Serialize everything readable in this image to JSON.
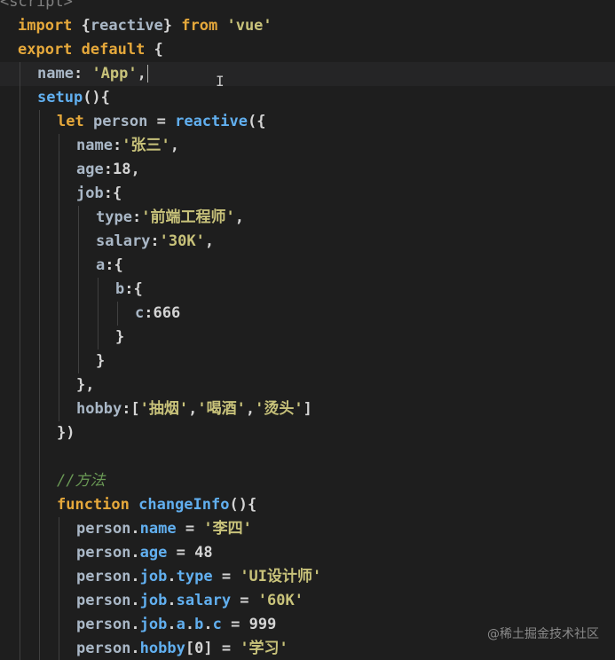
{
  "editor": {
    "lines": [
      {
        "indent": 0,
        "tokens": [
          {
            "t": "<script>",
            "c": "tag"
          }
        ]
      },
      {
        "indent": 0,
        "tokens": [
          {
            "t": "import ",
            "c": "kwo"
          },
          {
            "t": "{",
            "c": "pun"
          },
          {
            "t": "reactive",
            "c": "key"
          },
          {
            "t": "} ",
            "c": "pun"
          },
          {
            "t": "from ",
            "c": "kwo"
          },
          {
            "t": "'vue'",
            "c": "strc"
          }
        ]
      },
      {
        "indent": 0,
        "tokens": [
          {
            "t": "export ",
            "c": "kwo"
          },
          {
            "t": "default ",
            "c": "kwo"
          },
          {
            "t": "{",
            "c": "pun"
          }
        ]
      },
      {
        "indent": 1,
        "cursor": true,
        "tokens": [
          {
            "t": "name",
            "c": "key"
          },
          {
            "t": ": ",
            "c": "pun"
          },
          {
            "t": "'App'",
            "c": "strc"
          },
          {
            "t": ",",
            "c": "pun"
          }
        ]
      },
      {
        "indent": 1,
        "tokens": [
          {
            "t": "setup",
            "c": "fnc"
          },
          {
            "t": "(){",
            "c": "pun"
          }
        ]
      },
      {
        "indent": 2,
        "tokens": [
          {
            "t": "let ",
            "c": "kwo"
          },
          {
            "t": "person ",
            "c": "key"
          },
          {
            "t": "= ",
            "c": "pun"
          },
          {
            "t": "reactive",
            "c": "fnc"
          },
          {
            "t": "({",
            "c": "pun"
          }
        ]
      },
      {
        "indent": 3,
        "tokens": [
          {
            "t": "name",
            "c": "key"
          },
          {
            "t": ":",
            "c": "pun"
          },
          {
            "t": "'张三'",
            "c": "strc"
          },
          {
            "t": ",",
            "c": "pun"
          }
        ]
      },
      {
        "indent": 3,
        "tokens": [
          {
            "t": "age",
            "c": "key"
          },
          {
            "t": ":",
            "c": "pun"
          },
          {
            "t": "18",
            "c": "numc"
          },
          {
            "t": ",",
            "c": "pun"
          }
        ]
      },
      {
        "indent": 3,
        "tokens": [
          {
            "t": "job",
            "c": "key"
          },
          {
            "t": ":{",
            "c": "pun"
          }
        ]
      },
      {
        "indent": 4,
        "tokens": [
          {
            "t": "type",
            "c": "key"
          },
          {
            "t": ":",
            "c": "pun"
          },
          {
            "t": "'前端工程师'",
            "c": "strc"
          },
          {
            "t": ",",
            "c": "pun"
          }
        ]
      },
      {
        "indent": 4,
        "tokens": [
          {
            "t": "salary",
            "c": "key"
          },
          {
            "t": ":",
            "c": "pun"
          },
          {
            "t": "'30K'",
            "c": "strc"
          },
          {
            "t": ",",
            "c": "pun"
          }
        ]
      },
      {
        "indent": 4,
        "tokens": [
          {
            "t": "a",
            "c": "key"
          },
          {
            "t": ":{",
            "c": "pun"
          }
        ]
      },
      {
        "indent": 5,
        "tokens": [
          {
            "t": "b",
            "c": "key"
          },
          {
            "t": ":{",
            "c": "pun"
          }
        ]
      },
      {
        "indent": 6,
        "tokens": [
          {
            "t": "c",
            "c": "key"
          },
          {
            "t": ":",
            "c": "pun"
          },
          {
            "t": "666",
            "c": "numc"
          }
        ]
      },
      {
        "indent": 5,
        "tokens": [
          {
            "t": "}",
            "c": "pun"
          }
        ]
      },
      {
        "indent": 4,
        "tokens": [
          {
            "t": "}",
            "c": "pun"
          }
        ]
      },
      {
        "indent": 3,
        "tokens": [
          {
            "t": "},",
            "c": "pun"
          }
        ]
      },
      {
        "indent": 3,
        "tokens": [
          {
            "t": "hobby",
            "c": "key"
          },
          {
            "t": ":[",
            "c": "pun"
          },
          {
            "t": "'抽烟'",
            "c": "strc"
          },
          {
            "t": ",",
            "c": "pun"
          },
          {
            "t": "'喝酒'",
            "c": "strc"
          },
          {
            "t": ",",
            "c": "pun"
          },
          {
            "t": "'烫头'",
            "c": "strc"
          },
          {
            "t": "]",
            "c": "pun"
          }
        ]
      },
      {
        "indent": 2,
        "tokens": [
          {
            "t": "})",
            "c": "pun"
          }
        ]
      },
      {
        "indent": 2,
        "tokens": []
      },
      {
        "indent": 2,
        "tokens": [
          {
            "t": "//方法",
            "c": "cmt"
          }
        ]
      },
      {
        "indent": 2,
        "tokens": [
          {
            "t": "function ",
            "c": "kwo"
          },
          {
            "t": "changeInfo",
            "c": "fnc"
          },
          {
            "t": "(){",
            "c": "pun"
          }
        ]
      },
      {
        "indent": 3,
        "tokens": [
          {
            "t": "person",
            "c": "key"
          },
          {
            "t": ".",
            "c": "pun"
          },
          {
            "t": "name",
            "c": "fnc"
          },
          {
            "t": " = ",
            "c": "pun"
          },
          {
            "t": "'李四'",
            "c": "strc"
          }
        ]
      },
      {
        "indent": 3,
        "tokens": [
          {
            "t": "person",
            "c": "key"
          },
          {
            "t": ".",
            "c": "pun"
          },
          {
            "t": "age",
            "c": "fnc"
          },
          {
            "t": " = ",
            "c": "pun"
          },
          {
            "t": "48",
            "c": "numc"
          }
        ]
      },
      {
        "indent": 3,
        "tokens": [
          {
            "t": "person",
            "c": "key"
          },
          {
            "t": ".",
            "c": "pun"
          },
          {
            "t": "job",
            "c": "fnc"
          },
          {
            "t": ".",
            "c": "pun"
          },
          {
            "t": "type",
            "c": "fnc"
          },
          {
            "t": " = ",
            "c": "pun"
          },
          {
            "t": "'UI设计师'",
            "c": "strc"
          }
        ]
      },
      {
        "indent": 3,
        "tokens": [
          {
            "t": "person",
            "c": "key"
          },
          {
            "t": ".",
            "c": "pun"
          },
          {
            "t": "job",
            "c": "fnc"
          },
          {
            "t": ".",
            "c": "pun"
          },
          {
            "t": "salary",
            "c": "fnc"
          },
          {
            "t": " = ",
            "c": "pun"
          },
          {
            "t": "'60K'",
            "c": "strc"
          }
        ]
      },
      {
        "indent": 3,
        "tokens": [
          {
            "t": "person",
            "c": "key"
          },
          {
            "t": ".",
            "c": "pun"
          },
          {
            "t": "job",
            "c": "fnc"
          },
          {
            "t": ".",
            "c": "pun"
          },
          {
            "t": "a",
            "c": "fnc"
          },
          {
            "t": ".",
            "c": "pun"
          },
          {
            "t": "b",
            "c": "fnc"
          },
          {
            "t": ".",
            "c": "pun"
          },
          {
            "t": "c",
            "c": "fnc"
          },
          {
            "t": " = ",
            "c": "pun"
          },
          {
            "t": "999",
            "c": "numc"
          }
        ]
      },
      {
        "indent": 3,
        "tokens": [
          {
            "t": "person",
            "c": "key"
          },
          {
            "t": ".",
            "c": "pun"
          },
          {
            "t": "hobby",
            "c": "fnc"
          },
          {
            "t": "[",
            "c": "pun"
          },
          {
            "t": "0",
            "c": "numc"
          },
          {
            "t": "] = ",
            "c": "pun"
          },
          {
            "t": "'学习'",
            "c": "strc"
          }
        ]
      }
    ]
  },
  "mouse_cursor": {
    "glyph": "I",
    "icon": "text-cursor-icon"
  },
  "watermark": "@稀土掘金技术社区"
}
